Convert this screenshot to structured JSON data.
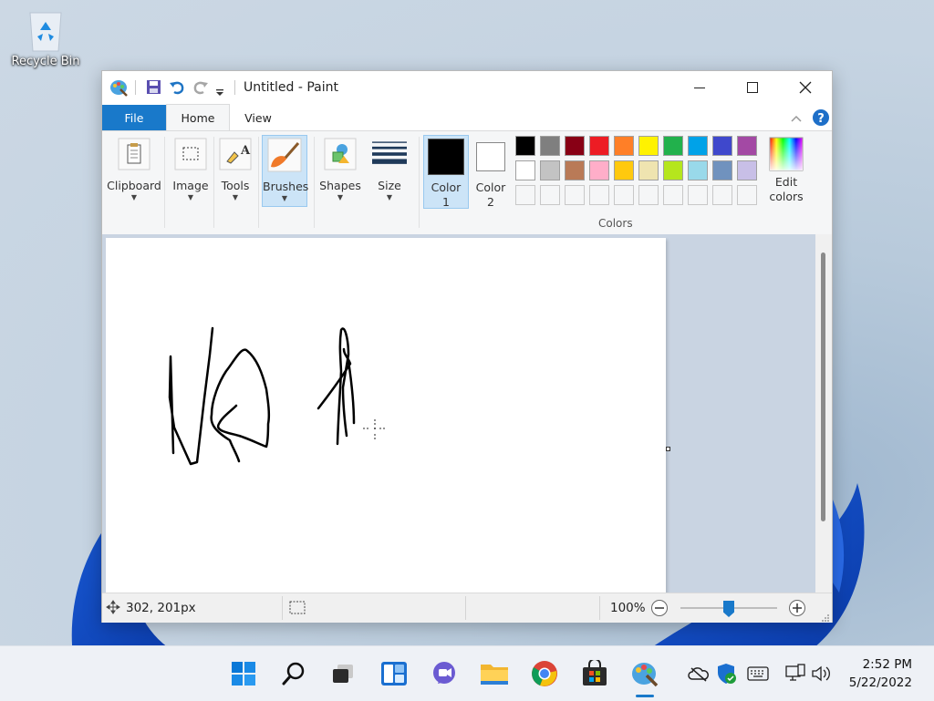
{
  "desktop": {
    "recycle_bin_label": "Recycle Bin"
  },
  "window": {
    "title": "Untitled - Paint",
    "tabs": {
      "file": "File",
      "home": "Home",
      "view": "View"
    },
    "ribbon": {
      "clipboard": "Clipboard",
      "image": "Image",
      "tools": "Tools",
      "brushes": "Brushes",
      "shapes": "Shapes",
      "size": "Size",
      "color1_a": "Color",
      "color1_b": "1",
      "color2_a": "Color",
      "color2_b": "2",
      "edit_colors_a": "Edit",
      "edit_colors_b": "colors",
      "colors_group": "Colors"
    },
    "palette_row1": [
      "#000000",
      "#7f7f7f",
      "#880015",
      "#ed1c24",
      "#ff7f27",
      "#fff200",
      "#22b14c",
      "#00a2e8",
      "#3f48cc",
      "#a349a4"
    ],
    "palette_row2": [
      "#ffffff",
      "#c3c3c3",
      "#b97a57",
      "#ffaec9",
      "#ffc90e",
      "#efe4b0",
      "#b5e61d",
      "#99d9ea",
      "#7092be",
      "#c8bfe7"
    ],
    "color1": "#000000",
    "color2": "#ffffff",
    "status": {
      "cursor_pos": "302, 201px",
      "zoom": "100%"
    }
  },
  "taskbar": {
    "time": "2:52 PM",
    "date": "5/22/2022"
  }
}
